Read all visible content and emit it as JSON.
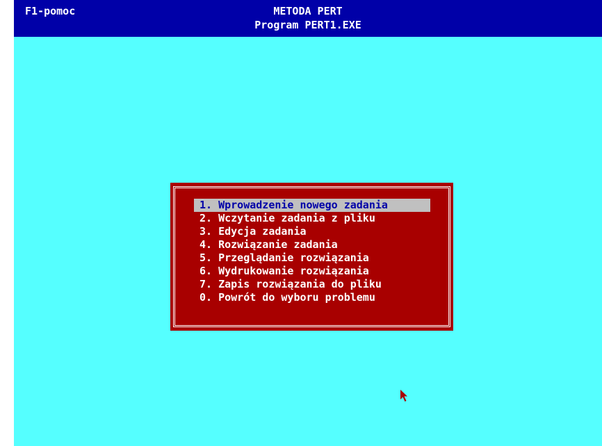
{
  "header": {
    "help_label": "F1-pomoc",
    "title": "METODA PERT",
    "subtitle": "Program PERT1.EXE"
  },
  "menu": {
    "selected_index": 0,
    "items": [
      {
        "label": "1. Wprowadzenie nowego zadania"
      },
      {
        "label": "2. Wczytanie zadania z pliku"
      },
      {
        "label": "3. Edycja zadania"
      },
      {
        "label": "4. Rozwiązanie zadania"
      },
      {
        "label": "5. Przeglądanie rozwiązania"
      },
      {
        "label": "6. Wydrukowanie rozwiązania"
      },
      {
        "label": "7. Zapis rozwiązania do pliku"
      },
      {
        "label": "0. Powrót do wyboru problemu"
      }
    ]
  },
  "colors": {
    "background": "#55ffff",
    "header": "#0000a8",
    "menu_box": "#a80000",
    "highlight": "#c0c0c0",
    "highlight_text": "#0000a8",
    "cursor": "#a80000"
  },
  "icons": {
    "cursor": "mouse-pointer-icon"
  }
}
